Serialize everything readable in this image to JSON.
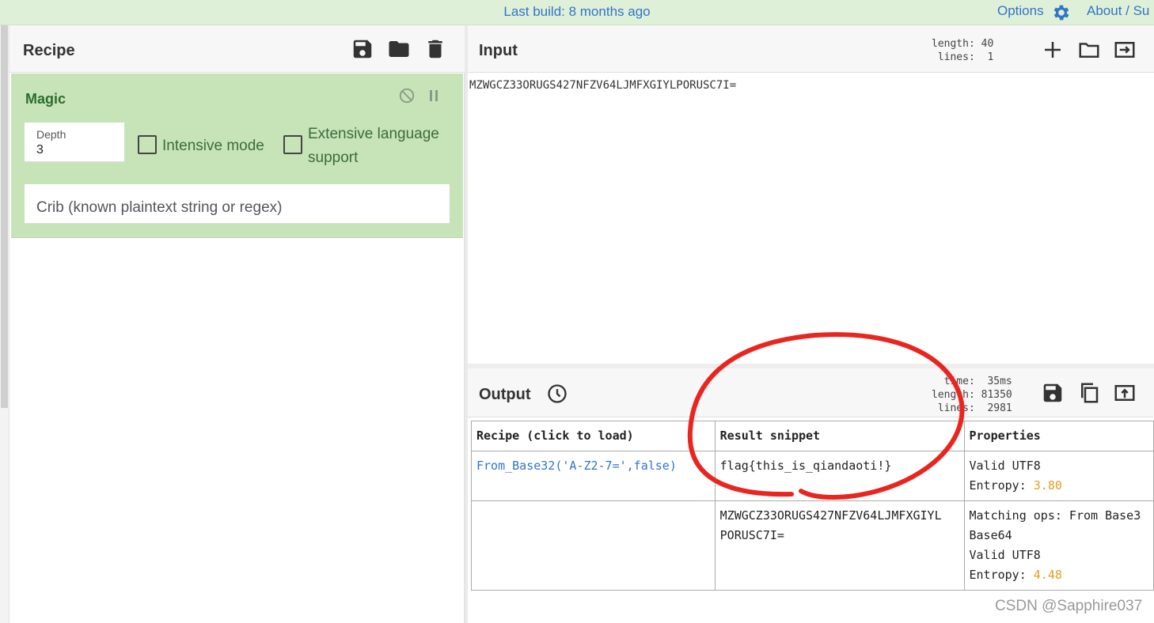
{
  "banner": {
    "last_build": "Last build: 8 months ago",
    "options": "Options",
    "about": "About / Su"
  },
  "recipe": {
    "title": "Recipe",
    "operation": {
      "name": "Magic",
      "depth_label": "Depth",
      "depth_value": "3",
      "intensive_mode_label": "Intensive mode",
      "extensive_language_label_1": "Extensive language",
      "extensive_language_label_2": "support",
      "crib_placeholder": "Crib (known plaintext string or regex)"
    }
  },
  "input": {
    "title": "Input",
    "stats": "length: 40\n lines:  1",
    "text": "MZWGCZ33ORUGS427NFZV64LJMFXGIYLPORUSC7I="
  },
  "output": {
    "title": "Output",
    "stats": "  time:  35ms\nlength: 81350\n lines:  2981",
    "table": {
      "headers": [
        "Recipe (click to load)",
        "Result snippet",
        "Properties"
      ],
      "rows": [
        {
          "recipe": "From_Base32('A-Z2-7=',false)",
          "snippet": "flag{this_is_qiandaoti!}",
          "properties_1": "Valid UTF8",
          "entropy_label": "Entropy: ",
          "entropy_value": "3.80"
        },
        {
          "recipe": "",
          "snippet_1": "MZWGCZ33ORUGS427NFZV64LJMFXGIYL",
          "snippet_2": "PORUSC7I=",
          "properties_1": "Matching ops: From Base3",
          "properties_2": "Base64",
          "properties_3": "Valid UTF8",
          "entropy_label": "Entropy: ",
          "entropy_value": "4.48"
        }
      ]
    }
  },
  "watermark": "CSDN @Sapphire037",
  "colors": {
    "accent_blue": "#3174c9",
    "operation_bg": "#c7e4b9",
    "annotation_red": "#e8261f",
    "entropy": "#e0a01e"
  }
}
